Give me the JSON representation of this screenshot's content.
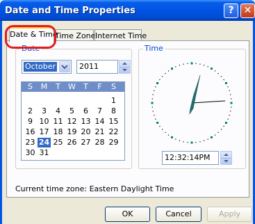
{
  "window": {
    "title": "Date and Time Properties",
    "help_glyph": "?",
    "close_glyph": "✕"
  },
  "tabs": [
    {
      "label": "Date & Time",
      "active": true
    },
    {
      "label": "Time Zone",
      "active": false
    },
    {
      "label": "Internet Time",
      "active": false
    }
  ],
  "date_group": {
    "label": "Date",
    "month": "October",
    "year": "2011",
    "weekdays": [
      "S",
      "M",
      "T",
      "W",
      "T",
      "F",
      "S"
    ],
    "weeks": [
      [
        "",
        "",
        "",
        "",
        "",
        "",
        "1"
      ],
      [
        "2",
        "3",
        "4",
        "5",
        "6",
        "7",
        "8"
      ],
      [
        "9",
        "10",
        "11",
        "12",
        "13",
        "14",
        "15"
      ],
      [
        "16",
        "17",
        "18",
        "19",
        "20",
        "21",
        "22"
      ],
      [
        "23",
        "24",
        "25",
        "26",
        "27",
        "28",
        "29"
      ],
      [
        "30",
        "31",
        "",
        "",
        "",
        "",
        ""
      ]
    ],
    "selected_day": "24"
  },
  "time_group": {
    "label": "Time",
    "time": "12:32:14PM"
  },
  "status": {
    "timezone_text": "Current time zone:  Eastern Daylight Time"
  },
  "buttons": {
    "ok": "OK",
    "cancel": "Cancel",
    "apply": "Apply"
  },
  "icons": {
    "dropdown": "chevron-down-icon",
    "spin": "spin-updown-icon",
    "clock": "analog-clock-icon",
    "help": "help-icon",
    "close": "close-icon"
  },
  "colors": {
    "titlebar": "#0054e3",
    "highlight_ring": "#e41c1c",
    "calendar_header": "#6f8ec8",
    "selection": "#316ac5",
    "clock_ticks": "#008080"
  }
}
